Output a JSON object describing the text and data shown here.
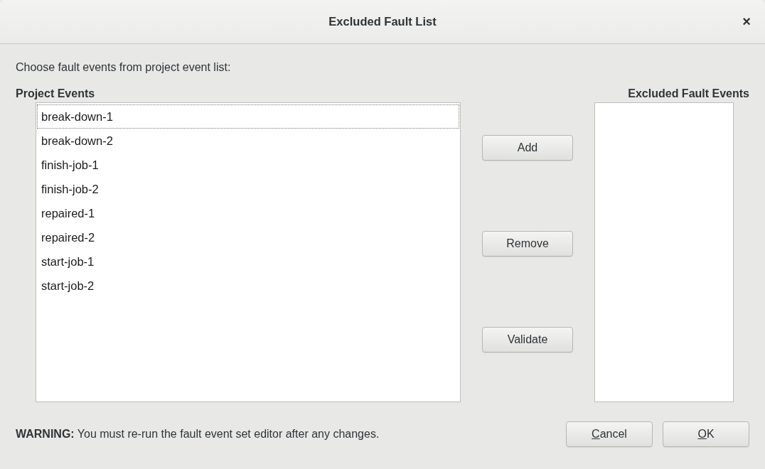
{
  "window": {
    "title": "Excluded Fault List",
    "close": "×"
  },
  "instruction": "Choose fault events from project event list:",
  "project_events": {
    "heading": "Project Events",
    "items": [
      {
        "label": "break-down-1",
        "focused": true
      },
      {
        "label": "break-down-2",
        "focused": false
      },
      {
        "label": "finish-job-1",
        "focused": false
      },
      {
        "label": "finish-job-2",
        "focused": false
      },
      {
        "label": "repaired-1",
        "focused": false
      },
      {
        "label": "repaired-2",
        "focused": false
      },
      {
        "label": "start-job-1",
        "focused": false
      },
      {
        "label": "start-job-2",
        "focused": false
      }
    ]
  },
  "actions": [
    {
      "label": "Add"
    },
    {
      "label": "Remove"
    },
    {
      "label": "Validate"
    }
  ],
  "excluded_events": {
    "heading": "Excluded Fault Events"
  },
  "warning": "**WARNING:** You must re-run the fault event set editor after any changes.",
  "buttons": [
    {
      "label": "Cancel",
      "mnemonic": true
    },
    {
      "label": "OK",
      "mnemonic": true
    }
  ]
}
